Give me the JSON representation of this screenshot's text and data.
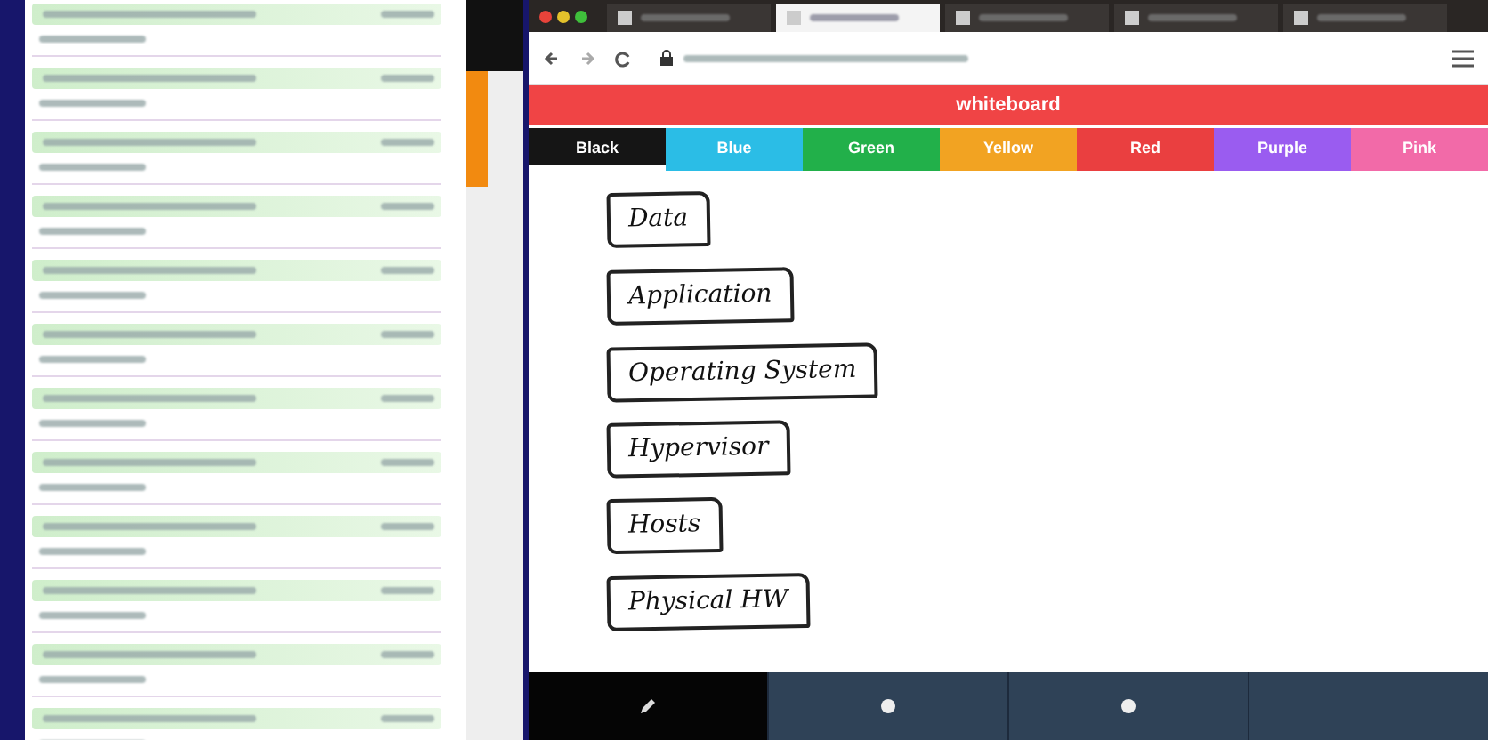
{
  "chat_list": {
    "rows": [
      {
        "kind": "message"
      },
      {
        "kind": "message"
      },
      {
        "kind": "message"
      },
      {
        "kind": "message"
      },
      {
        "kind": "message"
      },
      {
        "kind": "message"
      },
      {
        "kind": "message"
      },
      {
        "kind": "message"
      },
      {
        "kind": "message"
      },
      {
        "kind": "message"
      },
      {
        "kind": "message"
      },
      {
        "kind": "message"
      }
    ]
  },
  "browser": {
    "tabs": [
      {
        "selected": false
      },
      {
        "selected": true
      },
      {
        "selected": false
      },
      {
        "selected": false
      },
      {
        "selected": false
      }
    ]
  },
  "app": {
    "title": "whiteboard",
    "colors": [
      {
        "label": "Black",
        "color": "#151515",
        "selected": true
      },
      {
        "label": "Blue",
        "color": "#2bbde6",
        "selected": false
      },
      {
        "label": "Green",
        "color": "#22b04a",
        "selected": false
      },
      {
        "label": "Yellow",
        "color": "#f2a322",
        "selected": false
      },
      {
        "label": "Red",
        "color": "#ea3f40",
        "selected": false
      },
      {
        "label": "Purple",
        "color": "#9a5cf0",
        "selected": false
      },
      {
        "label": "Pink",
        "color": "#f26aa8",
        "selected": false
      }
    ],
    "notes": [
      {
        "text": "Data"
      },
      {
        "text": "Application"
      },
      {
        "text": "Operating System"
      },
      {
        "text": "Hypervisor"
      },
      {
        "text": "Hosts"
      },
      {
        "text": "Physical HW"
      }
    ],
    "tools": [
      {
        "kind": "pencil",
        "selected": true
      },
      {
        "kind": "dot",
        "selected": false
      },
      {
        "kind": "dot",
        "selected": false
      },
      {
        "kind": "blank",
        "selected": false
      }
    ]
  }
}
